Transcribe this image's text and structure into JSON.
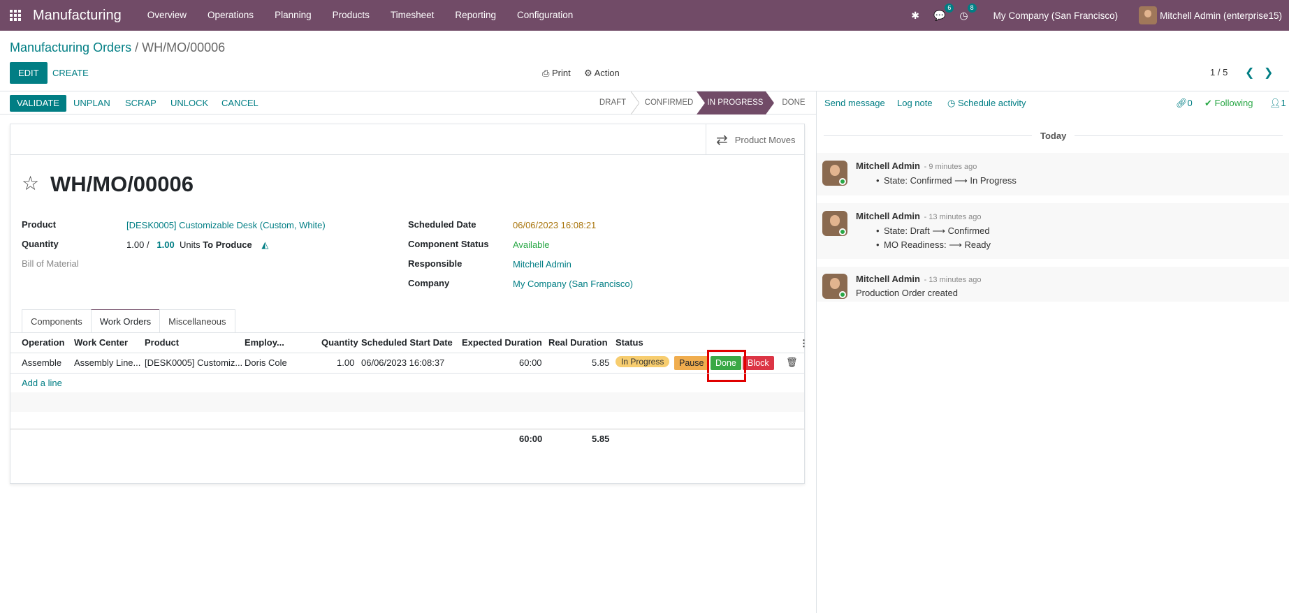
{
  "navbar": {
    "app_title": "Manufacturing",
    "menu": [
      "Overview",
      "Operations",
      "Planning",
      "Products",
      "Timesheet",
      "Reporting",
      "Configuration"
    ],
    "messages_badge": "6",
    "activities_badge": "8",
    "company": "My Company (San Francisco)",
    "user": "Mitchell Admin (enterprise15)"
  },
  "breadcrumb": {
    "parent": "Manufacturing Orders",
    "separator": "/",
    "current": "WH/MO/00006"
  },
  "controls": {
    "edit": "EDIT",
    "create": "CREATE",
    "print": "Print",
    "action": "Action",
    "pager": "1 / 5"
  },
  "statusbar": {
    "buttons": [
      "VALIDATE",
      "UNPLAN",
      "SCRAP",
      "UNLOCK",
      "CANCEL"
    ],
    "stages": [
      "DRAFT",
      "CONFIRMED",
      "IN PROGRESS",
      "DONE"
    ],
    "active_stage": "IN PROGRESS"
  },
  "smart_button": {
    "label": "Product Moves"
  },
  "record": {
    "name": "WH/MO/00006",
    "product_label": "Product",
    "product": "[DESK0005] Customizable Desk (Custom, White)",
    "quantity_label": "Quantity",
    "quantity_done": "1.00",
    "quantity_sep": "/",
    "quantity_total": "1.00",
    "uom": "Units",
    "to_produce": "To Produce",
    "bom_label": "Bill of Material",
    "scheduled_label": "Scheduled Date",
    "scheduled": "06/06/2023 16:08:21",
    "component_status_label": "Component Status",
    "component_status": "Available",
    "responsible_label": "Responsible",
    "responsible": "Mitchell Admin",
    "company_label": "Company",
    "company": "My Company (San Francisco)"
  },
  "tabs": [
    "Components",
    "Work Orders",
    "Miscellaneous"
  ],
  "active_tab": "Work Orders",
  "work_orders": {
    "columns": [
      "Operation",
      "Work Center",
      "Product",
      "Employ...",
      "Quantity",
      "Scheduled Start Date",
      "Expected Duration",
      "Real Duration",
      "Status"
    ],
    "rows": [
      {
        "operation": "Assemble",
        "work_center": "Assembly Line...",
        "product": "[DESK0005] Customiz...",
        "employee": "Doris Cole",
        "quantity": "1.00",
        "start": "06/06/2023 16:08:37",
        "expected": "60:00",
        "real": "5.85",
        "status": "In Progress",
        "pause": "Pause",
        "done": "Done",
        "block": "Block"
      }
    ],
    "add_line": "Add a line",
    "total_expected": "60:00",
    "total_real": "5.85"
  },
  "chatter": {
    "send_message": "Send message",
    "log_note": "Log note",
    "schedule_activity": "Schedule activity",
    "attachments": "0",
    "following": "Following",
    "followers": "1",
    "today": "Today",
    "messages": [
      {
        "author": "Mitchell Admin",
        "time": "- 9 minutes ago",
        "lines": [
          "State: Confirmed ⟶ In Progress"
        ]
      },
      {
        "author": "Mitchell Admin",
        "time": "- 13 minutes ago",
        "lines": [
          "State: Draft ⟶ Confirmed",
          "MO Readiness: ⟶ Ready"
        ]
      },
      {
        "author": "Mitchell Admin",
        "time": "- 13 minutes ago",
        "body": "Production Order created"
      }
    ]
  },
  "colors": {
    "brand": "#714B67",
    "accent": "#017e84",
    "done": "#3aa845",
    "block": "#dc3545",
    "pause": "#f0ad4e"
  }
}
